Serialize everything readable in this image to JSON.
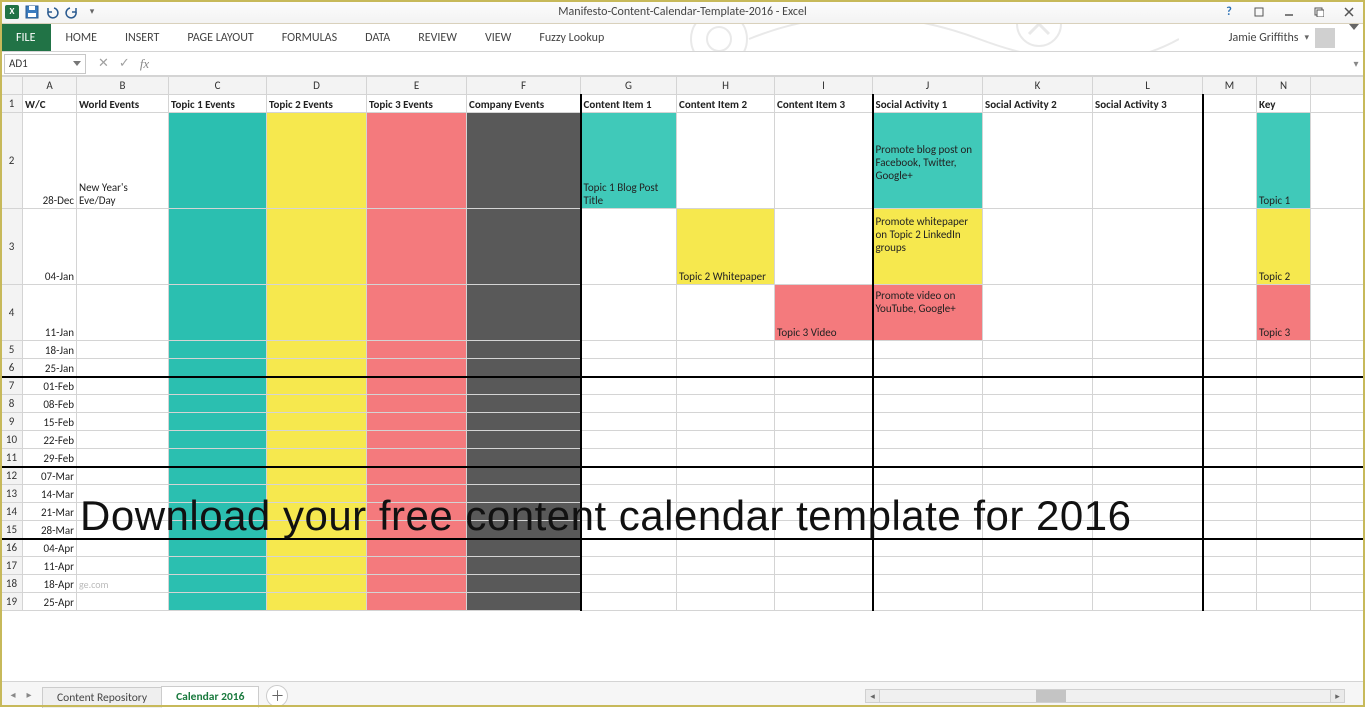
{
  "app": {
    "title": "Manifesto-Content-Calendar-Template-2016 - Excel",
    "user": "Jamie Griffiths"
  },
  "qat": {
    "save": "Save",
    "undo": "Undo",
    "redo": "Redo"
  },
  "ribbon": {
    "file": "FILE",
    "tabs": [
      "HOME",
      "INSERT",
      "PAGE LAYOUT",
      "FORMULAS",
      "DATA",
      "REVIEW",
      "VIEW",
      "Fuzzy Lookup"
    ]
  },
  "namebox": {
    "value": "AD1"
  },
  "formula": {
    "value": ""
  },
  "columns": [
    "A",
    "B",
    "C",
    "D",
    "E",
    "F",
    "G",
    "H",
    "I",
    "J",
    "K",
    "L",
    "M",
    "N"
  ],
  "headers": {
    "A": "W/C",
    "B": "World Events",
    "C": "Topic 1 Events",
    "D": "Topic 2 Events",
    "E": "Topic 3 Events",
    "F": "Company Events",
    "G": "Content Item 1",
    "H": "Content Item 2",
    "I": "Content Item 3",
    "J": "Social Activity 1",
    "K": "Social Activity 2",
    "L": "Social Activity 3",
    "M": "",
    "N": "Key"
  },
  "rows": [
    {
      "n": 2,
      "A": "28-Dec",
      "B": "New Year's Eve/Day",
      "G": "Topic 1 Blog Post Title",
      "J": "Promote blog post on Facebook, Twitter, Google+",
      "N": "Topic 1"
    },
    {
      "n": 3,
      "A": "04-Jan",
      "H": "Topic 2 Whitepaper",
      "J": "Promote whitepaper on Topic 2 LinkedIn groups",
      "N": "Topic 2"
    },
    {
      "n": 4,
      "A": "11-Jan",
      "I": "Topic 3 Video",
      "J": "Promote video on YouTube, Google+",
      "N": "Topic 3"
    },
    {
      "n": 5,
      "A": "18-Jan"
    },
    {
      "n": 6,
      "A": "25-Jan"
    },
    {
      "n": 7,
      "A": "01-Feb"
    },
    {
      "n": 8,
      "A": "08-Feb"
    },
    {
      "n": 9,
      "A": "15-Feb"
    },
    {
      "n": 10,
      "A": "22-Feb"
    },
    {
      "n": 11,
      "A": "29-Feb"
    },
    {
      "n": 12,
      "A": "07-Mar"
    },
    {
      "n": 13,
      "A": "14-Mar"
    },
    {
      "n": 14,
      "A": "21-Mar"
    },
    {
      "n": 15,
      "A": "28-Mar"
    },
    {
      "n": 16,
      "A": "04-Apr"
    },
    {
      "n": 17,
      "A": "11-Apr"
    },
    {
      "n": 18,
      "A": "18-Apr"
    },
    {
      "n": 19,
      "A": "25-Apr"
    }
  ],
  "sheets": {
    "tabs": [
      "Content Repository",
      "Calendar 2016"
    ],
    "active": 1
  },
  "overlay": "Download your free content calendar template for 2016",
  "watermark": "ge.com"
}
